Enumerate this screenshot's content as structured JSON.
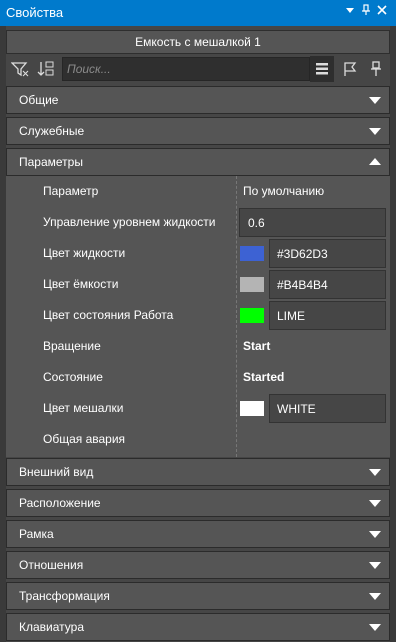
{
  "window": {
    "title": "Свойства",
    "pin_glyph": "⊥",
    "close_glyph": "✕"
  },
  "object_name": "Емкость с мешалкой 1",
  "search": {
    "placeholder": "Поиск..."
  },
  "toolbar": {
    "icons": [
      "filter-icon",
      "sort-icon",
      "list-view-icon",
      "flag-icon",
      "pin-icon"
    ]
  },
  "sections": [
    {
      "label": "Общие",
      "expanded": false
    },
    {
      "label": "Служебные",
      "expanded": false
    },
    {
      "label": "Параметры",
      "expanded": true
    },
    {
      "label": "Внешний вид",
      "expanded": false
    },
    {
      "label": "Расположение",
      "expanded": false
    },
    {
      "label": "Рамка",
      "expanded": false
    },
    {
      "label": "Отношения",
      "expanded": false
    },
    {
      "label": "Трансформация",
      "expanded": false
    },
    {
      "label": "Клавиатура",
      "expanded": false
    }
  ],
  "parameters": {
    "header": {
      "name": "Параметр",
      "value": "По умолчанию"
    },
    "rows": [
      {
        "name": "Управление уровнем жидкости",
        "value": "0.6",
        "kind": "input"
      },
      {
        "name": "Цвет жидкости",
        "value": "#3D62D3",
        "swatch": "#3D62D3",
        "kind": "color"
      },
      {
        "name": "Цвет ёмкости",
        "value": "#B4B4B4",
        "swatch": "#B4B4B4",
        "kind": "color"
      },
      {
        "name": "Цвет состояния Работа",
        "value": "LIME",
        "swatch": "#00FF00",
        "kind": "color"
      },
      {
        "name": "Вращение",
        "value": "Start",
        "kind": "bold"
      },
      {
        "name": "Состояние",
        "value": "Started",
        "kind": "bold"
      },
      {
        "name": "Цвет мешалки",
        "value": "WHITE",
        "swatch": "#FFFFFF",
        "kind": "color"
      },
      {
        "name": "Общая авария",
        "value": "",
        "kind": "empty"
      }
    ]
  },
  "colors": {
    "titlebar": "#007ACC",
    "panel": "#464646",
    "section": "#555555"
  }
}
